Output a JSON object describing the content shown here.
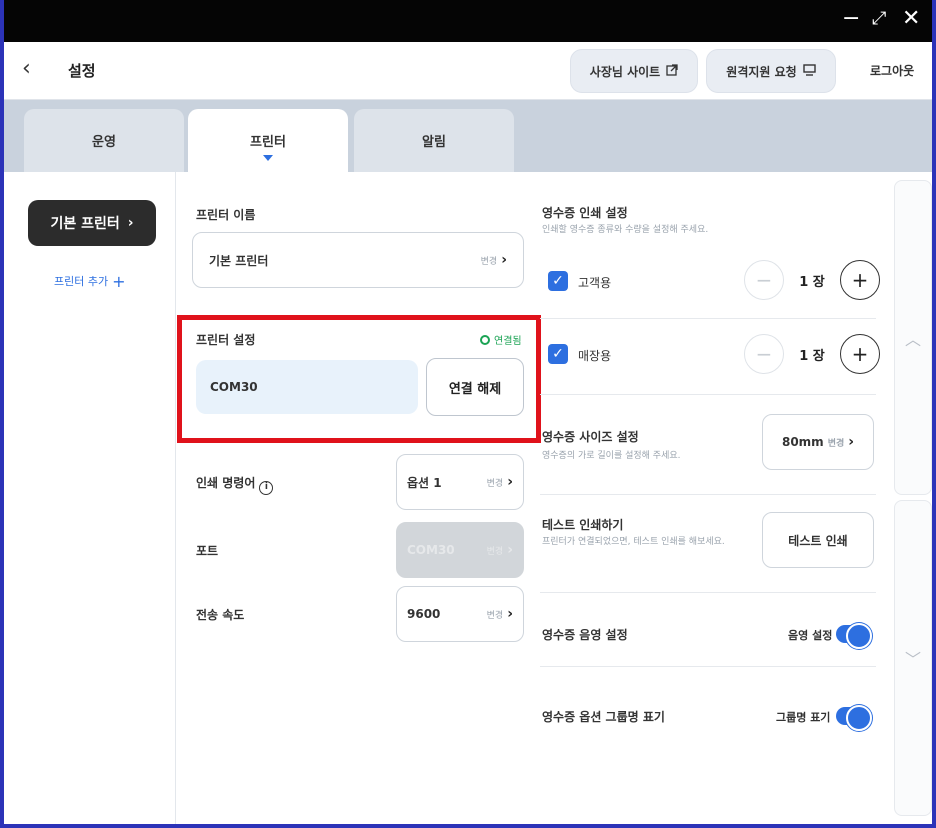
{
  "window": {
    "minimize": "−",
    "maximize": "⤢",
    "close": "✕"
  },
  "header": {
    "back": "‹",
    "title": "설정",
    "owner_site": "사장님 사이트",
    "owner_site_icon": "external-link-icon",
    "remote_support": "원격지원 요청",
    "remote_support_icon": "monitor-icon",
    "logout": "로그아웃"
  },
  "tabs": [
    {
      "label": "운영",
      "active": false
    },
    {
      "label": "프린터",
      "active": true
    },
    {
      "label": "알림",
      "active": false
    }
  ],
  "sidebar": {
    "primary": "기본 프린터",
    "primary_chevron": "›",
    "add": "프린터 추가",
    "add_icon": "+"
  },
  "printer": {
    "name_label": "프린터 이름",
    "name_value": "기본 프린터",
    "change": "변경",
    "chevron": "›",
    "settings_label": "프린터 설정",
    "status": "연결됨",
    "port_value": "COM30",
    "disconnect": "연결 해제",
    "lang_label": "인쇄 명령어",
    "lang_value": "옵션 1",
    "port_label": "포트",
    "port_select_value": "COM30",
    "speed_label": "전송 속도",
    "speed_value": "9600"
  },
  "receipt": {
    "print_label": "영수증 인쇄 설정",
    "print_sub": "인쇄할 영수증 종류와 수량을 설정해 주세요.",
    "customer": "고객용",
    "customer_count": "1 장",
    "store": "매장용",
    "store_count": "1 장",
    "minus": "−",
    "plus": "+",
    "check": "✓",
    "size_label": "영수증 사이즈 설정",
    "size_sub": "영수증의 가로 길이를 설정해 주세요.",
    "size_value": "80mm",
    "test_label": "테스트 인쇄하기",
    "test_sub": "프린터가 연결되었으면, 테스트 인쇄를 해보세요.",
    "test_button": "테스트 인쇄",
    "sound_label": "영수증 음영 설정",
    "sound_toggle": "음영 설정",
    "group_label": "영수증 옵션 그룹명 표기",
    "group_toggle": "그룹명 표기"
  },
  "scroll": {
    "up": "︿",
    "down": "﹀"
  },
  "colors": {
    "accent": "#2d6fe0",
    "highlight": "#e0121b",
    "status": "#1ba354"
  }
}
